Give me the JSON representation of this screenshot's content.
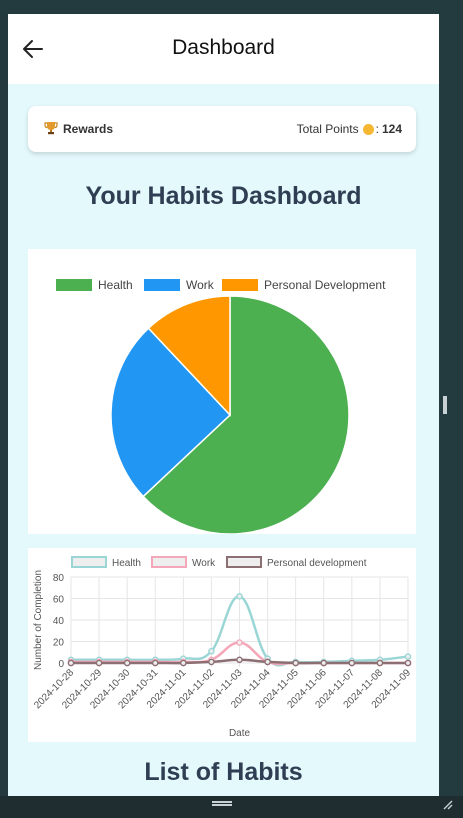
{
  "header": {
    "title": "Dashboard",
    "back_icon": "arrow-left-icon"
  },
  "rewards": {
    "label": "Rewards",
    "icon": "trophy-icon",
    "points_label": "Total Points",
    "points_separator": ":",
    "points_value": "124",
    "coin_icon": "coin-icon"
  },
  "main": {
    "dashboard_title": "Your Habits Dashboard",
    "list_title": "List of Habits"
  },
  "colors": {
    "health": "#4caf50",
    "work": "#2196f3",
    "personal": "#ff9800",
    "line_health": "#9bd6d6",
    "line_work": "#f4a7b9",
    "line_personal": "#8c6f73"
  },
  "chart_data": [
    {
      "type": "pie",
      "categories": [
        "Health",
        "Work",
        "Personal Development"
      ],
      "values": [
        63,
        25,
        12
      ],
      "legend_position": "top"
    },
    {
      "type": "line",
      "x": [
        "2024-10-28",
        "2024-10-29",
        "2024-10-30",
        "2024-10-31",
        "2024-11-01",
        "2024-11-02",
        "2024-11-03",
        "2024-11-04",
        "2024-11-05",
        "2024-11-06",
        "2024-11-07",
        "2024-11-08",
        "2024-11-09"
      ],
      "series": [
        {
          "name": "Health",
          "values": [
            3,
            3,
            3,
            3,
            4,
            11,
            62,
            4,
            1,
            1,
            2,
            3,
            6
          ]
        },
        {
          "name": "Work",
          "values": [
            1,
            1,
            1,
            1,
            1,
            3,
            19,
            1,
            0,
            0,
            0,
            0,
            0
          ]
        },
        {
          "name": "Personal development",
          "values": [
            0,
            0,
            0,
            0,
            0,
            1,
            3,
            1,
            0,
            0,
            0,
            0,
            0
          ]
        }
      ],
      "xlabel": "Date",
      "ylabel": "Number of Completion",
      "ylim": [
        0,
        80
      ],
      "yticks": [
        0,
        20,
        40,
        60,
        80
      ],
      "grid": true,
      "legend_position": "top"
    }
  ]
}
